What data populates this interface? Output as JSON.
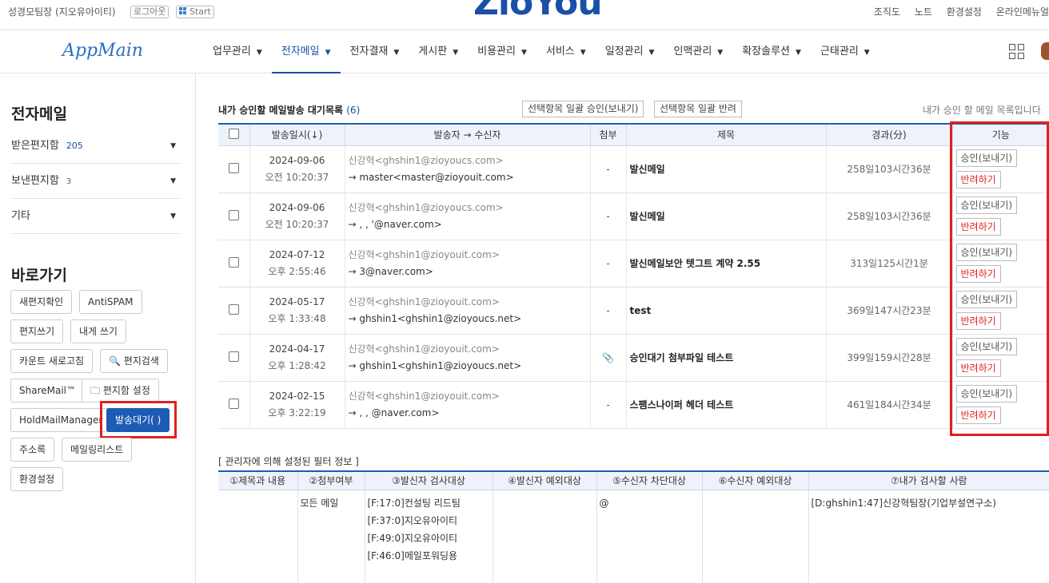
{
  "topbar": {
    "user": "성경모팀장 (지오유아이티)",
    "logout": "로그아웃",
    "start": "Start",
    "logo": "ZioYou",
    "links": [
      "조직도",
      "노트",
      "환경설정",
      "온라인메뉴얼"
    ]
  },
  "nav": {
    "brand": "AppMain",
    "menu": [
      "업무관리",
      "전자메일",
      "전자결재",
      "게시판",
      "비용관리",
      "서비스",
      "일정관리",
      "인맥관리",
      "확장솔루션",
      "근태관리"
    ],
    "active": "전자메일"
  },
  "sidebar": {
    "title": "전자메일",
    "items": [
      {
        "label": "받은편지함",
        "count": "205"
      },
      {
        "label": "보낸편지함",
        "count": "3"
      },
      {
        "label": "기타",
        "count": ""
      }
    ],
    "quick_title": "바로가기",
    "quick": {
      "new_mail_check": "새편지확인",
      "antispam": "AntiSPAM",
      "write": "편지쓰기",
      "write_self": "내게 쓰기",
      "count_refresh": "카운트 새로고침",
      "search": "편지검색",
      "sharemail": "ShareMail™",
      "mailbox_settings": "편지함 설정",
      "holdmail": "HoldMailManager",
      "pending": "발송대기( )",
      "address": "주소록",
      "mailing": "메일링리스트",
      "settings": "환경설정"
    }
  },
  "main": {
    "title": "내가 승인할 메일발송 대기목록",
    "count": "(6)",
    "bulk_approve": "선택항목 일괄 승인(보내기)",
    "bulk_reject": "선택항목 일괄 반려",
    "right_note": "내가 승인 할 메일 목록입니다",
    "columns": [
      "발송일시(↓)",
      "발송자 → 수신자",
      "첨부",
      "제목",
      "경과(分)",
      "기능"
    ],
    "approve_label": "승인(보내기)",
    "reject_label": "반려하기",
    "rows": [
      {
        "date": "2024-09-06",
        "time": "오전 10:20:37",
        "from": "신강혁<ghshin1@zioyoucs.com>",
        "to": "→ master<master@zioyouit.com>",
        "att": "-",
        "subject": "발신메일",
        "elapsed": "258일103시간36분"
      },
      {
        "date": "2024-09-06",
        "time": "오전 10:20:37",
        "from": "신강혁<ghshin1@zioyoucs.com>",
        "to": "→ ,               ,              '@naver.com>",
        "att": "-",
        "subject": "발신메일",
        "elapsed": "258일103시간36분"
      },
      {
        "date": "2024-07-12",
        "time": "오후 2:55:46",
        "from": "신강혁<ghshin1@zioyouit.com>",
        "to": "→                                 3@naver.com>",
        "att": "-",
        "subject": "발신메일보안 텟그트 계약 2.55",
        "elapsed": "313일125시간1분"
      },
      {
        "date": "2024-05-17",
        "time": "오후 1:33:48",
        "from": "신강혁<ghshin1@zioyouit.com>",
        "to": "→ ghshin1<ghshin1@zioyoucs.net>",
        "att": "-",
        "subject": "test",
        "elapsed": "369일147시간23분"
      },
      {
        "date": "2024-04-17",
        "time": "오후 1:28:42",
        "from": "신강혁<ghshin1@zioyouit.com>",
        "to": "→ ghshin1<ghshin1@zioyoucs.net>",
        "att": "📎",
        "subject": "승인대기 첨부파일 테스트",
        "elapsed": "399일159시간28분"
      },
      {
        "date": "2024-02-15",
        "time": "오후 3:22:19",
        "from": "신강혁<ghshin1@zioyouit.com>",
        "to": "→ ,                         ,      @naver.com>",
        "att": "-",
        "subject": "스팸스나이퍼 헤더 테스트",
        "elapsed": "461일184시간34분"
      }
    ]
  },
  "filter": {
    "title": "[ 관리자에 의해 설정된 필터 정보 ]",
    "columns": [
      "①제목과 내용",
      "②첨부여부",
      "③발신자 검사대상",
      "④발신자 예외대상",
      "⑤수신자 차단대상",
      "⑥수신자 예외대상",
      "⑦내가 검사할 사람"
    ],
    "values": {
      "subject": "",
      "attach": "모든 메일",
      "sender_check": [
        "[F:17:0]컨설팅 리드팀",
        "[F:37:0]지오유아이티",
        "[F:49:0]지오유아이티",
        "[F:46:0]메일포워딩용"
      ],
      "sender_except": "",
      "recipient_block": "@",
      "recipient_except": "",
      "my_check": "[D:ghshin1:47]신강혁팀장(기업부설연구소)"
    }
  },
  "colors": {
    "accent": "#1e5bb5",
    "highlight": "#e02020"
  }
}
